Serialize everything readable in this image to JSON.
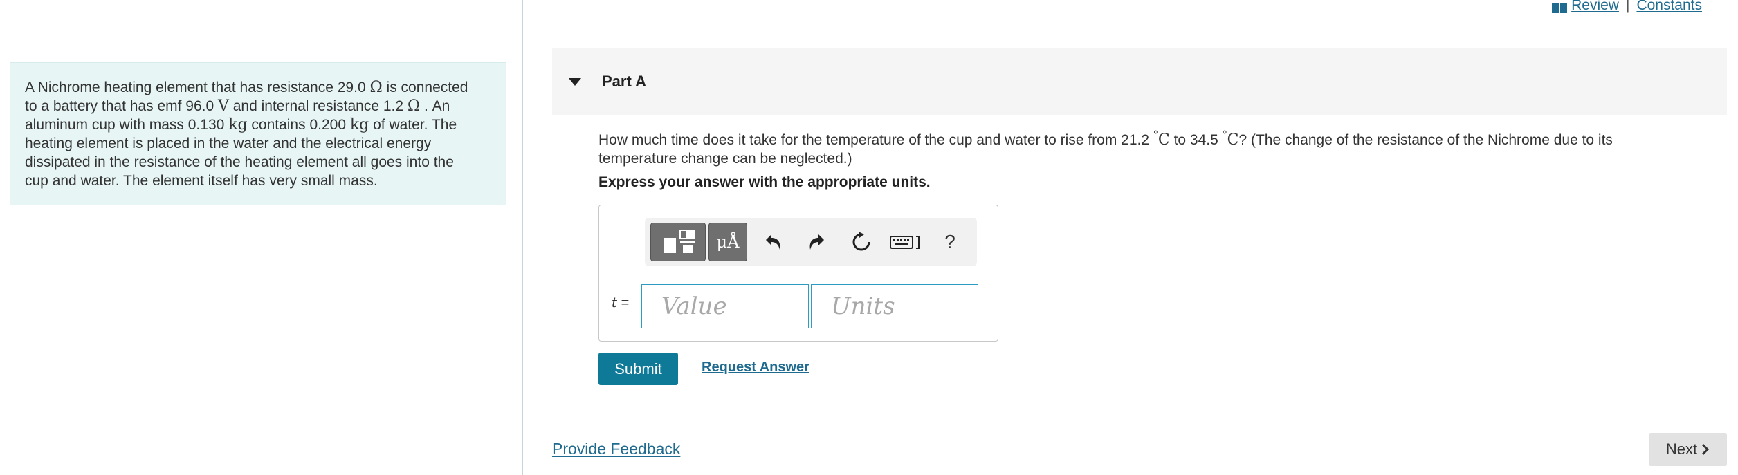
{
  "nav": {
    "review": "Review",
    "separator": "|",
    "constants": "Constants"
  },
  "problem": {
    "t1": "A Nichrome heating element that has resistance 29.0 ",
    "m1": "Ω",
    "t2": " is connected",
    "t3": "to a battery that has emf 96.0 ",
    "m2": "V",
    "t4": " and internal resistance 1.2 ",
    "m3": "Ω",
    "t5": " . An",
    "t6": "aluminum cup with mass 0.130 ",
    "m4": "kg",
    "t7": " contains 0.200 ",
    "m5": "kg",
    "t8": " of water. The",
    "t9": "heating element is placed in the water and the electrical energy",
    "t10": "dissipated in the resistance of the heating element all goes into the",
    "t11": "cup and water. The element itself has very small mass."
  },
  "part": {
    "title": "Part A"
  },
  "question": {
    "q1": "How much time does it take for the temperature of the cup and water to rise from 21.2 ",
    "deg1": "°",
    "c1": "C",
    "q2": " to 34.5 ",
    "deg2": "°",
    "c2": "C",
    "q3": "? (The change of the resistance of the Nichrome due to its",
    "q4": "temperature change can be neglected.)"
  },
  "instruction": "Express your answer with the appropriate units.",
  "toolbar": {
    "units_glyph": "μÅ",
    "help_glyph": "?"
  },
  "answer": {
    "variable": "t",
    "equals": " =",
    "value_placeholder": "Value",
    "units_placeholder": "Units"
  },
  "buttons": {
    "submit": "Submit",
    "request_answer": "Request Answer",
    "provide_feedback": "Provide Feedback",
    "next": "Next"
  },
  "colors": {
    "accent": "#0e7a98",
    "link": "#1f6b8f",
    "problem_bg": "#e7f5f5",
    "input_border": "#2d9bc2"
  }
}
